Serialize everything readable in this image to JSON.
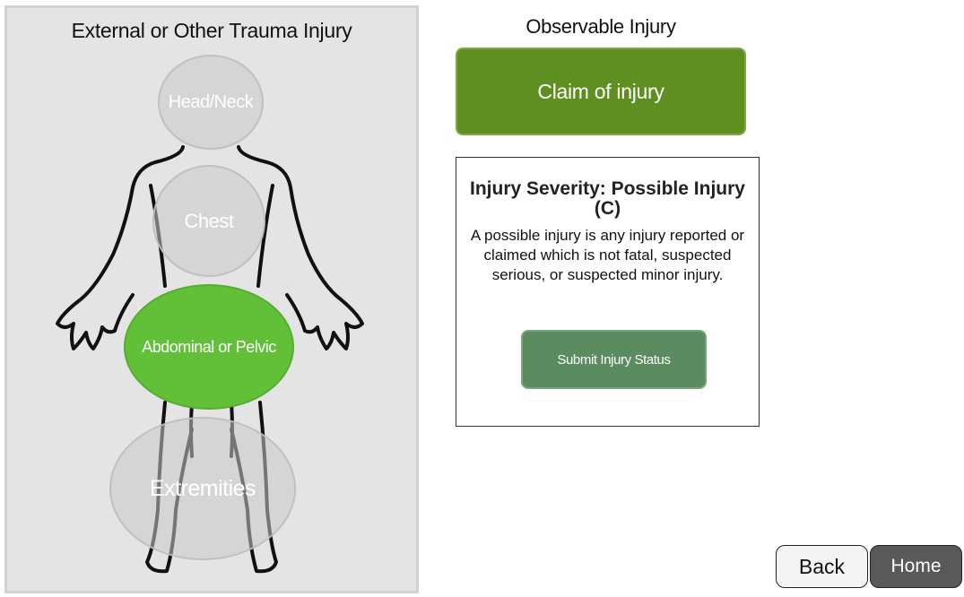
{
  "body_map": {
    "title": "External or Other Trauma Injury",
    "regions": {
      "head_neck": "Head/Neck",
      "chest": "Chest",
      "abdominal_pelvic": "Abdominal or Pelvic",
      "extremities": "Extremities"
    },
    "selected_region": "Abdominal or Pelvic"
  },
  "observable": {
    "label": "Observable Injury",
    "claim_button": "Claim of injury"
  },
  "severity": {
    "title": "Injury Severity: Possible Injury (C)",
    "description": "A possible injury is any injury reported or claimed which is not fatal, suspected serious, or suspected minor injury.",
    "submit_button": "Submit Injury Status"
  },
  "nav": {
    "back": "Back",
    "home": "Home"
  },
  "colors": {
    "selected_region": "#62c038",
    "claim_button": "#5e8f20",
    "submit_button": "#5b8c5f",
    "home_button": "#595959"
  }
}
